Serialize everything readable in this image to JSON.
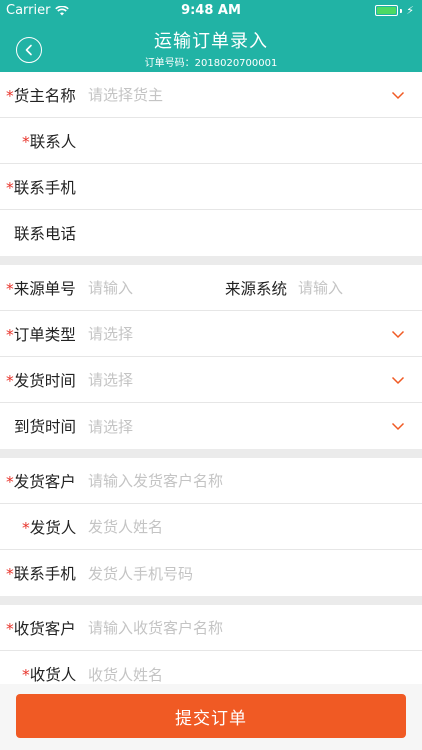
{
  "status_bar": {
    "carrier": "Carrier",
    "time": "9:48 AM"
  },
  "header": {
    "title": "运输订单录入",
    "subtitle": "订单号码：2018020700001"
  },
  "required_mark": "*",
  "section1": {
    "shipper_label": "货主名称",
    "shipper_placeholder": "请选择货主",
    "contact_label": "联系人",
    "mobile_label": "联系手机",
    "phone_label": "联系电话"
  },
  "section2": {
    "source_no_label": "来源单号",
    "source_no_placeholder": "请输入",
    "source_sys_label": "来源系统",
    "source_sys_placeholder": "请输入",
    "order_type_label": "订单类型",
    "order_type_placeholder": "请选择",
    "ship_time_label": "发货时间",
    "ship_time_placeholder": "请选择",
    "arrive_time_label": "到货时间",
    "arrive_time_placeholder": "请选择"
  },
  "section3": {
    "sender_customer_label": "发货客户",
    "sender_customer_placeholder": "请输入发货客户名称",
    "sender_label": "发货人",
    "sender_placeholder": "发货人姓名",
    "sender_mobile_label": "联系手机",
    "sender_mobile_placeholder": "发货人手机号码"
  },
  "section4": {
    "receiver_customer_label": "收货客户",
    "receiver_customer_placeholder": "请输入收货客户名称",
    "receiver_label": "收货人",
    "receiver_placeholder": "收货人姓名"
  },
  "submit_label": "提交订单",
  "colors": {
    "header": "#21b3a5",
    "accent": "#f05a24",
    "required": "#e8342b"
  }
}
